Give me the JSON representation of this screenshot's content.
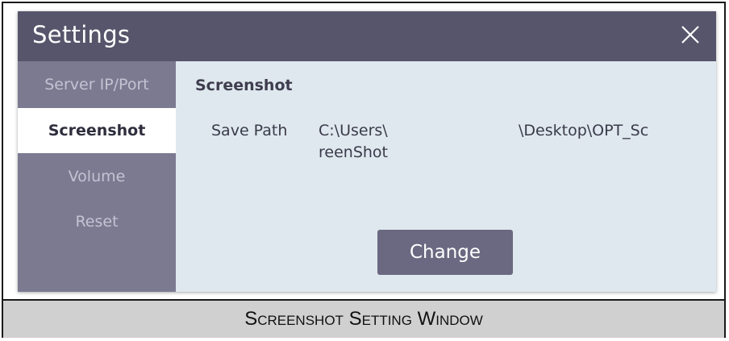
{
  "window": {
    "title": "Settings",
    "close_icon": "close-icon",
    "colors": {
      "titlebar": "#56556b",
      "sidebar": "#7b7a91",
      "content": "#dfe8ee",
      "button": "#6a6981"
    }
  },
  "sidebar": {
    "items": [
      {
        "label": "Server IP/Port",
        "active": false
      },
      {
        "label": "Screenshot",
        "active": true
      },
      {
        "label": "Volume",
        "active": false
      },
      {
        "label": "Reset",
        "active": false
      }
    ]
  },
  "content": {
    "section_title": "Screenshot",
    "save_path_label": "Save Path",
    "save_path_line1_start": "C:\\Users\\",
    "save_path_line1_end": "\\Desktop\\OPT_Sc",
    "save_path_line2": "reenShot",
    "change_button": "Change"
  },
  "caption": "Screenshot Setting Window"
}
